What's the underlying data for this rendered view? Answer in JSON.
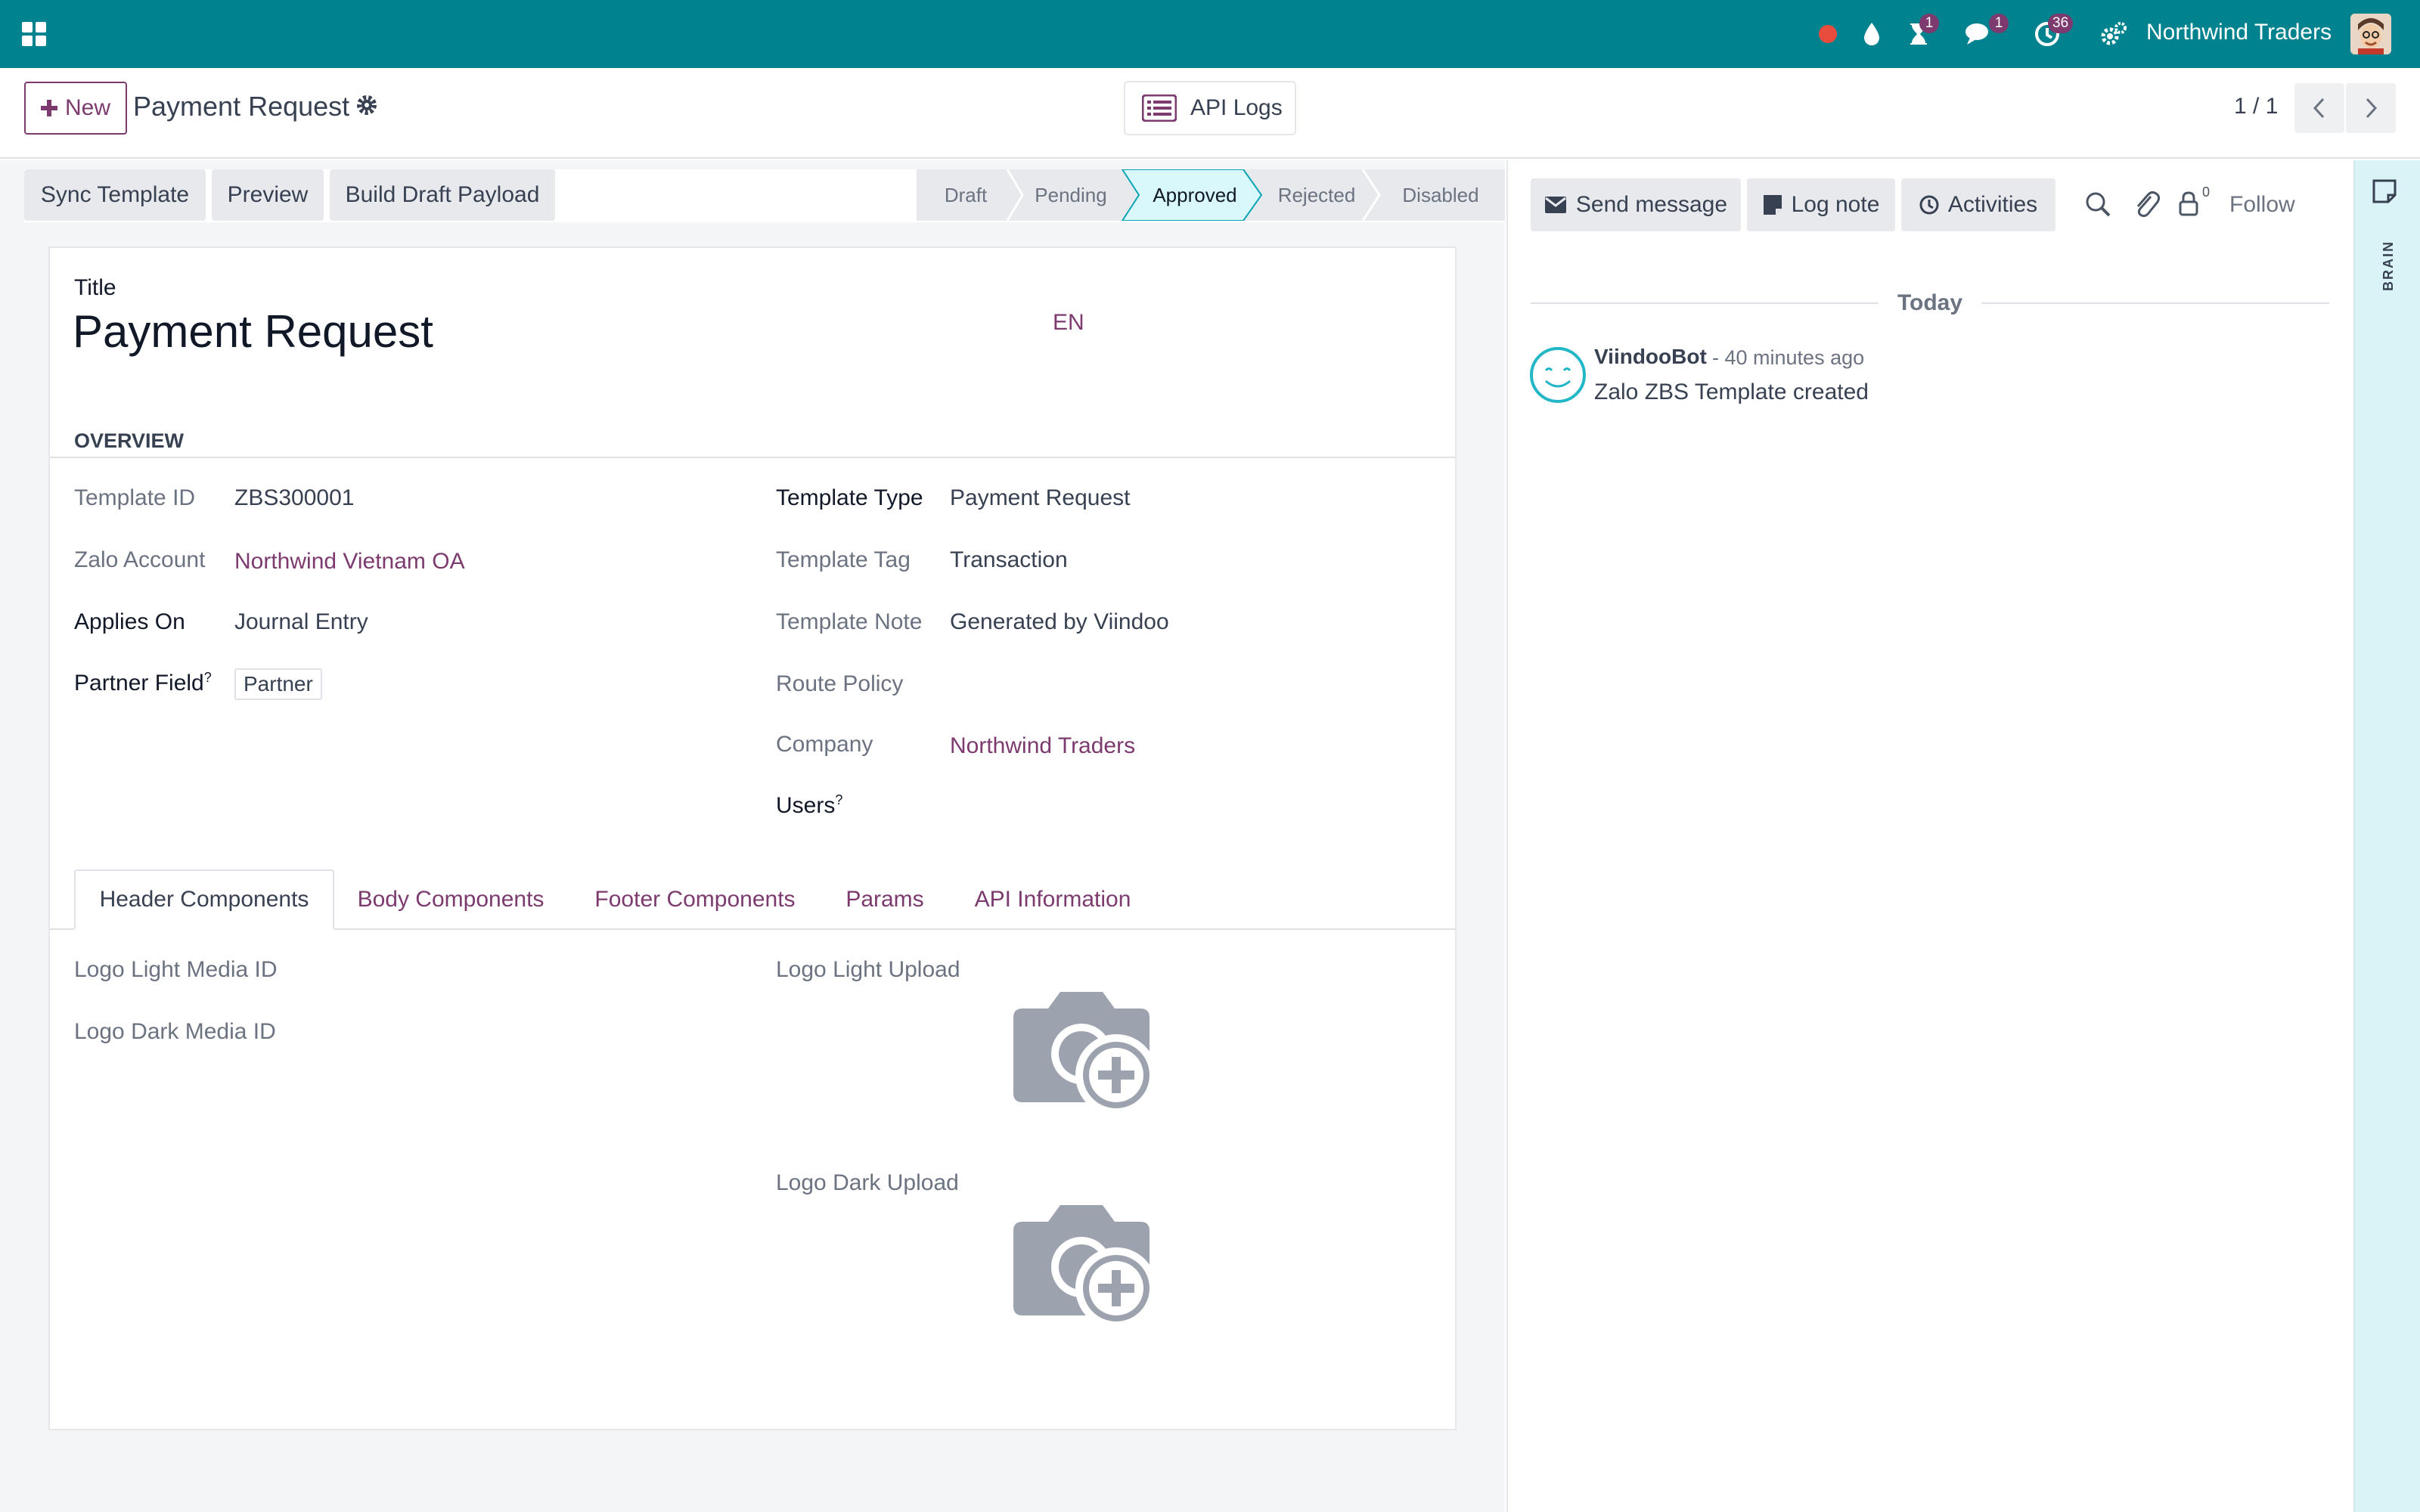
{
  "navbar": {
    "company": "Northwind Traders",
    "activity_badge": "1",
    "messages_badge": "1",
    "clock_badge": "36",
    "colors": {
      "bar": "#00838f",
      "badge": "#7c3a6e",
      "record_dot": "#e74c3c"
    }
  },
  "control_panel": {
    "new_label": "New",
    "breadcrumb_title": "Payment Request",
    "api_logs_label": "API Logs",
    "pager": "1 / 1"
  },
  "statusbar": {
    "buttons": [
      "Sync Template",
      "Preview",
      "Build Draft Payload"
    ],
    "stages": [
      "Draft",
      "Pending",
      "Approved",
      "Rejected",
      "Disabled"
    ],
    "active_stage": "Approved"
  },
  "form": {
    "title_label": "Title",
    "title_value": "Payment Request",
    "lang": "EN",
    "section": "OVERVIEW",
    "left": [
      {
        "label": "Template ID",
        "value": "ZBS300001"
      },
      {
        "label": "Zalo Account",
        "value": "Northwind Vietnam OA"
      },
      {
        "label": "Applies On",
        "value": "Journal Entry"
      },
      {
        "label": "Partner Field",
        "value": "Partner",
        "help": "?"
      }
    ],
    "right": [
      {
        "label": "Template Type",
        "value": "Payment Request"
      },
      {
        "label": "Template Tag",
        "value": "Transaction"
      },
      {
        "label": "Template Note",
        "value": "Generated by Viindoo"
      },
      {
        "label": "Route Policy",
        "value": ""
      },
      {
        "label": "Company",
        "value": "Northwind Traders"
      },
      {
        "label": "Users",
        "value": "",
        "help": "?"
      }
    ],
    "tabs": [
      "Header Components",
      "Body Components",
      "Footer Components",
      "Params",
      "API Information"
    ],
    "active_tab": "Header Components",
    "header_tab": {
      "logo_light_media_id": "Logo Light Media ID",
      "logo_dark_media_id": "Logo Dark Media ID",
      "logo_light_upload": "Logo Light Upload",
      "logo_dark_upload": "Logo Dark Upload"
    }
  },
  "chatter": {
    "send_message": "Send message",
    "log_note": "Log note",
    "activities": "Activities",
    "followers_count": "0",
    "follow": "Follow",
    "date_separator": "Today",
    "message": {
      "author": "ViindooBot",
      "time": "- 40 minutes ago",
      "body": "Zalo ZBS Template created"
    }
  },
  "side_panel": {
    "label": "BRAIN"
  }
}
